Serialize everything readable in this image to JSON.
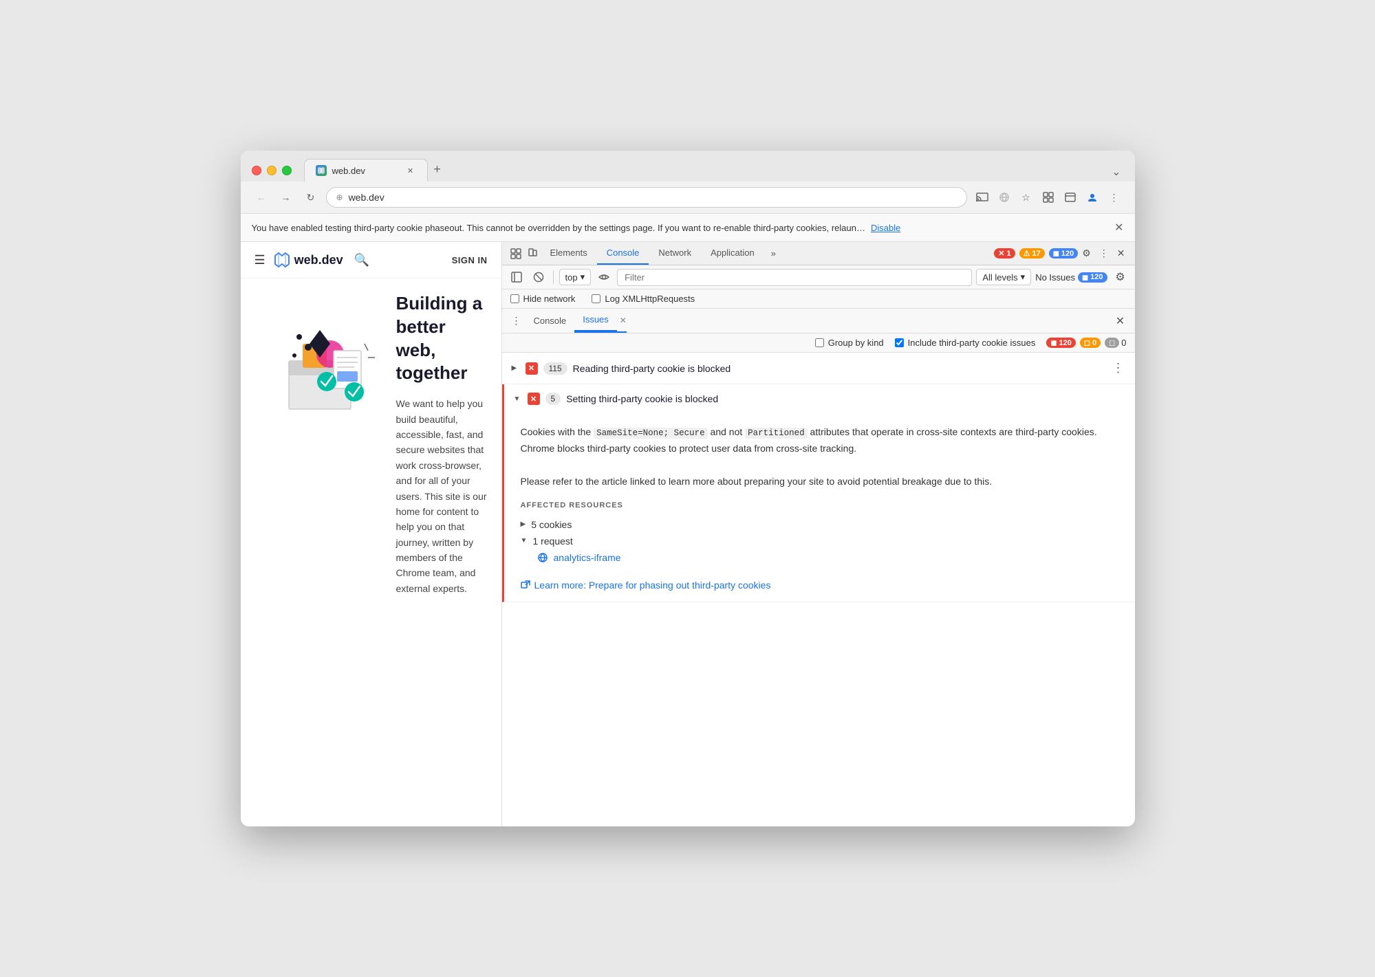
{
  "browser": {
    "tab_title": "web.dev",
    "tab_url": "web.dev",
    "new_tab_label": "+",
    "collapse_label": "⌄"
  },
  "navbar": {
    "back_label": "←",
    "forward_label": "→",
    "reload_label": "↻",
    "url": "web.dev",
    "cast_label": "⬡",
    "screen_mirror_label": "⊗",
    "bookmark_label": "☆",
    "extension_label": "□",
    "devtools_label": "⚙",
    "profile_label": "👤",
    "more_label": "⋮"
  },
  "info_bar": {
    "message": "You have enabled testing third-party cookie phaseout. This cannot be overridden by the settings page. If you want to re-enable third-party cookies, relaun…",
    "link_text": "Disable",
    "close_label": "✕"
  },
  "website": {
    "nav": {
      "menu_label": "☰",
      "logo_text": "web.dev",
      "search_label": "🔍",
      "signin_label": "SIGN IN"
    },
    "hero": {
      "title": "Building a better web, together",
      "description": "We want to help you build beautiful, accessible, fast, and secure websites that work cross-browser, and for all of your users. This site is our home for content to help you on that journey, written by members of the Chrome team, and external experts."
    }
  },
  "devtools": {
    "tabs": [
      {
        "label": "Elements",
        "active": false
      },
      {
        "label": "Console",
        "active": false
      },
      {
        "label": "Network",
        "active": false
      },
      {
        "label": "Application",
        "active": false
      }
    ],
    "more_tabs_label": "»",
    "badges": {
      "errors": "1",
      "warnings": "17",
      "issues": "120"
    },
    "settings_label": "⚙",
    "more_label": "⋮",
    "close_label": "✕",
    "console_toolbar": {
      "sidebar_label": "▣",
      "clear_label": "🚫",
      "top_label": "top",
      "dropdown_arrow": "▾",
      "eye_label": "👁",
      "filter_placeholder": "Filter",
      "levels_label": "All levels",
      "no_issues_label": "No Issues",
      "no_issues_count": "120",
      "settings_gear_label": "⚙"
    },
    "checkboxes": {
      "hide_network": "Hide network",
      "log_xmlhttp": "Log XMLHttpRequests"
    },
    "issues_toolbar": {
      "more_label": "⋮",
      "console_tab": "Console",
      "issues_tab": "Issues",
      "close_label": "✕"
    },
    "issues_options": {
      "group_by_kind": "Group by kind",
      "include_third_party": "Include third-party cookie issues",
      "count": "120",
      "count2": "0",
      "count3": "0"
    },
    "issues": [
      {
        "id": 1,
        "expanded": false,
        "count": "115",
        "title": "Reading third-party cookie is blocked",
        "more_label": "⋮"
      },
      {
        "id": 2,
        "expanded": true,
        "count": "5",
        "title": "Setting third-party cookie is blocked",
        "description_parts": [
          "Cookies with the ",
          "SameSite=None; Secure",
          " and not ",
          "Partitioned",
          " attributes that operate in cross-site contexts are third-party cookies. Chrome blocks third-party cookies to protect user data from cross-site tracking.",
          "\n\nPlease refer to the article linked to learn more about preparing your site to avoid potential breakage due to this."
        ],
        "affected_title": "AFFECTED RESOURCES",
        "affected_items": [
          {
            "label": "5 cookies",
            "expanded": false,
            "type": "cookies"
          },
          {
            "label": "1 request",
            "expanded": true,
            "type": "request",
            "children": [
              {
                "label": "analytics-iframe",
                "type": "link"
              }
            ]
          }
        ],
        "learn_more_text": "Learn more: Prepare for phasing out third-party cookies",
        "learn_more_url": "#"
      }
    ]
  }
}
